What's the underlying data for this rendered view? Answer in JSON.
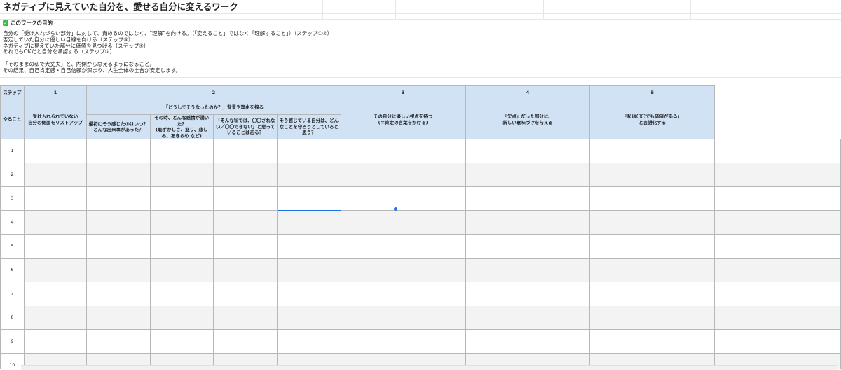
{
  "title": "ネガティブに見えていた自分を、愛せる自分に変えるワーク",
  "purpose": {
    "heading": "このワークの目的",
    "lines": [
      "自分の「受け入れづらい部分」に対して、責めるのではなく、“理解”を向ける。（「変えること」ではなく「理解すること」）（ステップ①②）",
      "否定していた自分に優しい目線を向ける（ステップ③）",
      "ネガティブに見えていた部分に価値を見つける（ステップ④）",
      "それでもOKだと自分を承認する（ステップ⑤）",
      "",
      "「そのままの私で大丈夫」と、内側から思えるようになること。",
      "その結果、自己肯定感・自己信頼が深まり、人生全体の土台が安定します。"
    ]
  },
  "table": {
    "step_label": "ステップ",
    "todo_label": "やること",
    "steps": [
      "1",
      "2",
      "3",
      "4",
      "5"
    ],
    "step2_group": "「どうしてそうなったのか？」背景や理由を探る",
    "tasks": {
      "s1": "受け入れられていない\n自分の側面をリストアップ",
      "s2a": "最初にそう感じたのはいつ？\nどんな出来事があった？",
      "s2b": "その時、どんな感情が湧いた？\n(恥ずかしさ、怒り、悲しみ、あきらめ など)",
      "s2c": "「そんな私では、〇〇されない／〇〇できない」と思っていることはある？",
      "s2d": "そう感じている自分は、どんなことを守ろうとしていると思う？",
      "s3": "その自分に優しい視点を持つ\n(＝肯定の言葉をかける)",
      "s4": "「欠点」だった部分に、\n新しい意味づけを与える",
      "s5": "「私は〇〇でも価値がある」\nと言語化する"
    },
    "rows": [
      "1",
      "2",
      "3",
      "4",
      "5",
      "6",
      "7",
      "8",
      "9",
      "10"
    ]
  },
  "colors": {
    "header_bg": "#d0e2f3",
    "alt_row": "#f3f3f3",
    "selection": "#1a73e8",
    "check": "#39b54a"
  }
}
